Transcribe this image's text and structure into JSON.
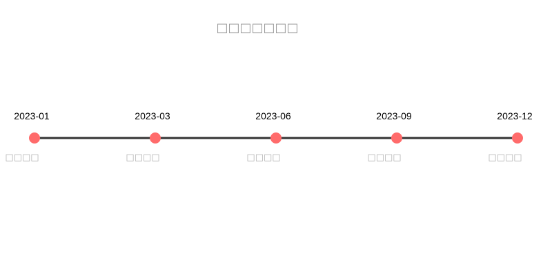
{
  "title": "□□□□□□□",
  "colors": {
    "line": "#333333",
    "node": "#ff6b6b",
    "date_text": "#000000",
    "event_text": "#b0b0b0",
    "title_text": "#9a9a9a"
  },
  "timeline": {
    "milestones": [
      {
        "date": "2023-01",
        "label": "□□□□"
      },
      {
        "date": "2023-03",
        "label": "□□□□"
      },
      {
        "date": "2023-06",
        "label": "□□□□"
      },
      {
        "date": "2023-09",
        "label": "□□□□"
      },
      {
        "date": "2023-12",
        "label": "□□□□"
      }
    ]
  }
}
